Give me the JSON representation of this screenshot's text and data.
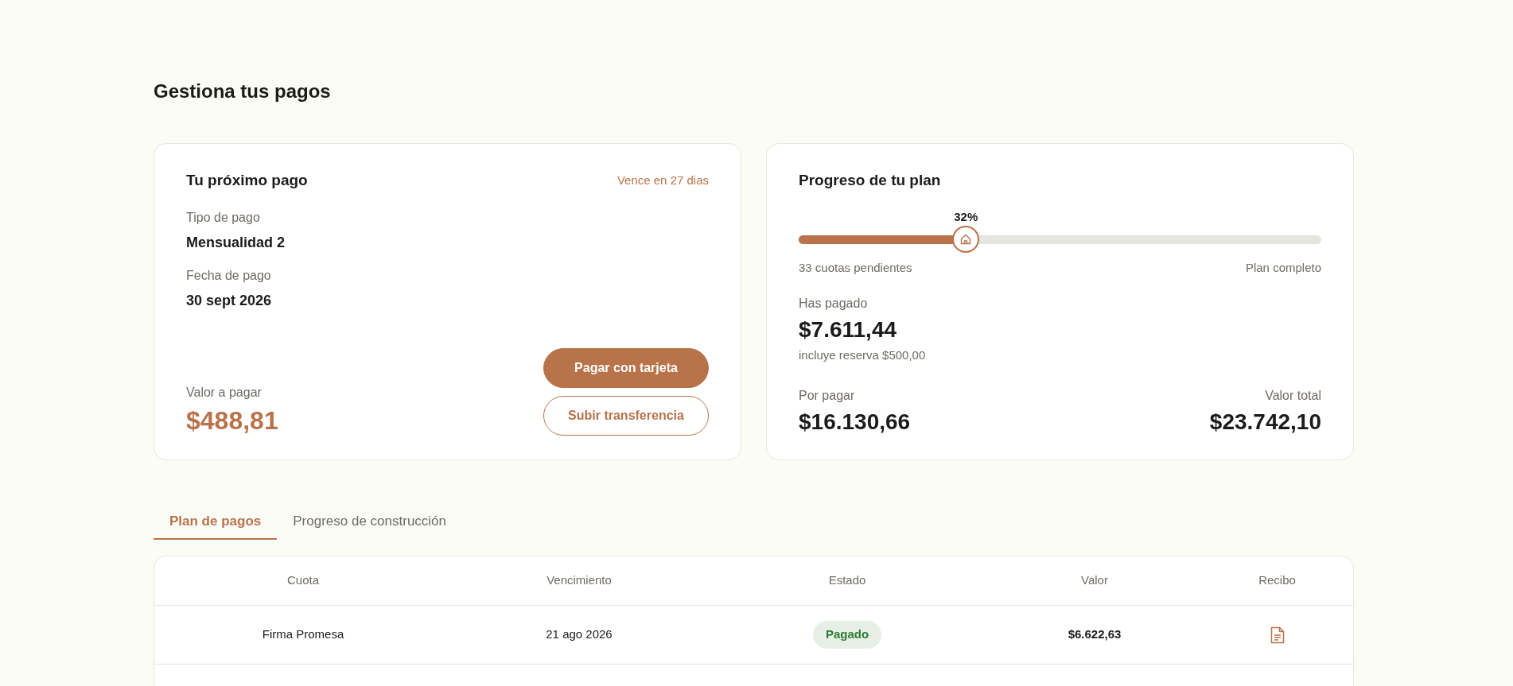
{
  "page_title": "Gestiona tus pagos",
  "next_payment": {
    "title": "Tu próximo pago",
    "due_note": "Vence en 27 dias",
    "fields": [
      {
        "label": "Tipo de pago",
        "value": "Mensualidad 2"
      },
      {
        "label": "Fecha de pago",
        "value": "30 sept 2026"
      }
    ],
    "amount_label": "Valor a pagar",
    "amount": "$488,81",
    "buttons": [
      {
        "label": "Pagar con tarjeta",
        "kind": "primary"
      },
      {
        "label": "Subir transferencia",
        "kind": "secondary"
      }
    ]
  },
  "plan_progress": {
    "title": "Progreso de tu plan",
    "percent": "32%",
    "level": 0.32,
    "left_caption": "33 cuotas pendientes",
    "right_caption": "Plan completo",
    "paid_label": "Has pagado",
    "paid": "$7.611,44",
    "paid_note": "incluye reserva $500,00",
    "due_label": "Por pagar",
    "due": "$16.130,66",
    "total_label": "Valor total",
    "total": "$23.742,10"
  },
  "tabs": [
    {
      "label": "Plan de pagos",
      "selected": true
    },
    {
      "label": "Progreso de construcción",
      "selected": false
    }
  ],
  "table": {
    "columns": [
      "Cuota",
      "Vencimiento",
      "Estado",
      "Valor",
      "Recibo"
    ],
    "rows": [
      {
        "cuota": "Firma Promesa",
        "vencimiento": "21 ago 2026",
        "estado": "Pagado",
        "kind": "paid",
        "valor": "$6.622,63",
        "receipt": true
      }
    ]
  }
}
